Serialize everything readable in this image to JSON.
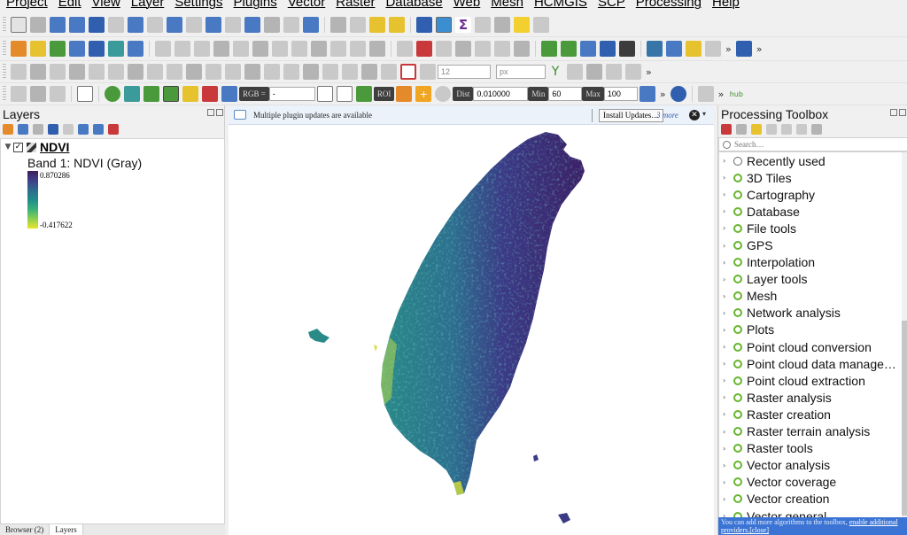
{
  "menu": [
    "Project",
    "Edit",
    "View",
    "Layer",
    "Settings",
    "Plugins",
    "Vector",
    "Raster",
    "Database",
    "Web",
    "Mesh",
    "HCMGIS",
    "SCP",
    "Processing",
    "Help"
  ],
  "toolbar3": {
    "stroke_size": "12",
    "stroke_unit": "px"
  },
  "toolbar4": {
    "rgb_label": "RGB =",
    "rgb_value": "-",
    "roi_label": "ROI",
    "dist_label": "Dist",
    "dist_value": "0.010000",
    "min_label": "Min",
    "min_value": "60",
    "max_label": "Max",
    "max_value": "100",
    "hub_label": "hub"
  },
  "layers_panel": {
    "title": "Layers",
    "layer_name": "NDVI",
    "band_label": "Band 1: NDVI (Gray)",
    "legend_max": "0.870286",
    "legend_min": "-0.417622",
    "tabs": [
      "Browser (2)",
      "Layers"
    ]
  },
  "message_bar": {
    "text": "Multiple plugin updates are available",
    "button": "Install Updates…",
    "more": "3 more"
  },
  "processing": {
    "title": "Processing Toolbox",
    "search_placeholder": "Search…",
    "items": [
      "Recently used",
      "3D Tiles",
      "Cartography",
      "Database",
      "File tools",
      "GPS",
      "Interpolation",
      "Layer tools",
      "Mesh",
      "Network analysis",
      "Plots",
      "Point cloud conversion",
      "Point cloud data manage…",
      "Point cloud extraction",
      "Raster analysis",
      "Raster creation",
      "Raster terrain analysis",
      "Raster tools",
      "Vector analysis",
      "Vector coverage",
      "Vector creation",
      "Vector general"
    ],
    "info_text": "You can add more algorithms to the toolbox, ",
    "info_link": "enable additional providers.",
    "info_close": "[close]"
  },
  "colors": {
    "ndvi_high": "#3b1f5c",
    "ndvi_mid": "#228c8a",
    "ndvi_low": "#e8e52a",
    "accent": "#3b74d4"
  }
}
